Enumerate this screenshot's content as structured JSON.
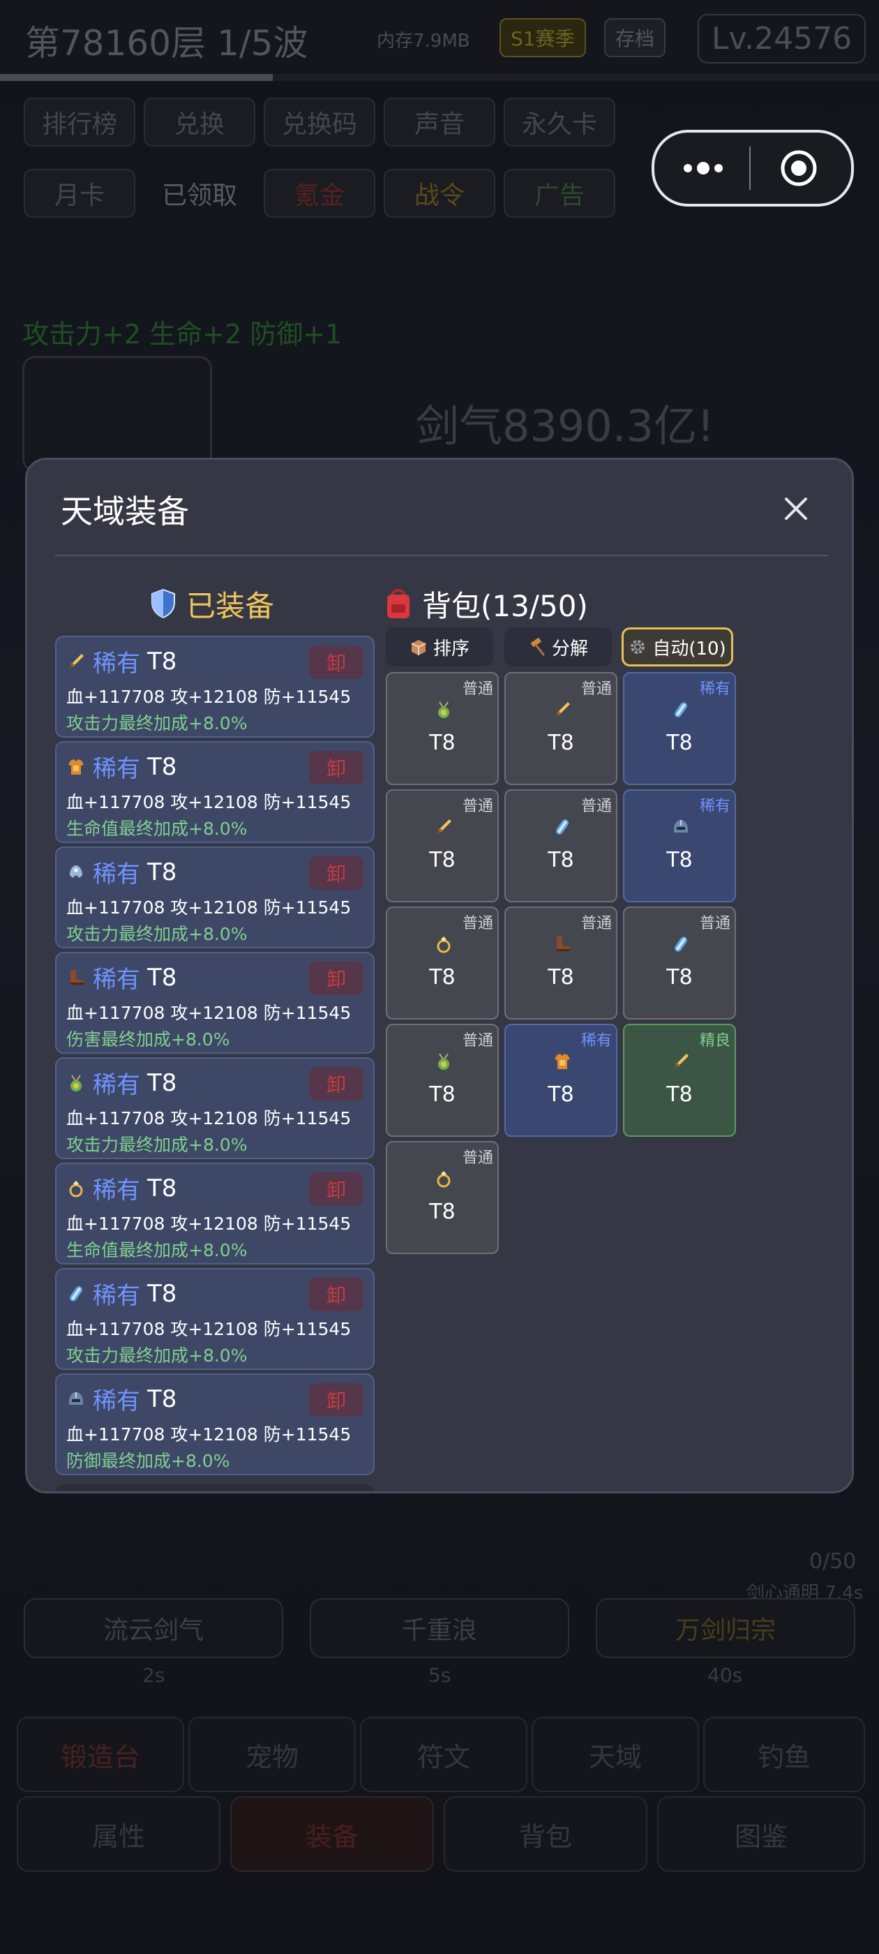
{
  "background": {
    "floor_label": "第78160层  1/5波",
    "memory_label": "内存7.9MB",
    "season_chip": "S1赛季",
    "save_chip": "存档",
    "level_chip": "Lv.24576",
    "progress_fraction": 0.31,
    "top_buttons": [
      "排行榜",
      "兑换",
      "兑换码",
      "声音",
      "永久卡"
    ],
    "second_buttons": [
      "月卡",
      "已领取",
      "氪金",
      "战令",
      "广告"
    ],
    "buff_text": "攻击力+2 生命+2 防御+1",
    "sword_qi": "剑气8390.3亿!",
    "skills": [
      {
        "name": "流云剑气",
        "cd": "2s"
      },
      {
        "name": "千重浪",
        "cd": "5s"
      },
      {
        "name": "万剑归宗",
        "cd": "40s"
      }
    ],
    "skill_count": "0/50",
    "skill_note": "剑心通明 7.4s",
    "nav_row1": [
      "锻造台",
      "宠物",
      "符文",
      "天域",
      "钓鱼"
    ],
    "nav_row2": [
      "属性",
      "装备",
      "背包",
      "图鉴"
    ]
  },
  "modal": {
    "title": "天域装备",
    "equipped": {
      "title": "已装备",
      "unequip_label": "卸",
      "items": [
        {
          "icon": "sword-icon",
          "rarity": "稀有",
          "tier": "T8",
          "stats": "血+117708 攻+12108 防+11545",
          "bonus": "攻击力最终加成+8.0%"
        },
        {
          "icon": "armor-icon",
          "rarity": "稀有",
          "tier": "T8",
          "stats": "血+117708 攻+12108 防+11545",
          "bonus": "生命值最终加成+8.0%"
        },
        {
          "icon": "shoulder-icon",
          "rarity": "稀有",
          "tier": "T8",
          "stats": "血+117708 攻+12108 防+11545",
          "bonus": "攻击力最终加成+8.0%"
        },
        {
          "icon": "boot-icon",
          "rarity": "稀有",
          "tier": "T8",
          "stats": "血+117708 攻+12108 防+11545",
          "bonus": "伤害最终加成+8.0%"
        },
        {
          "icon": "amulet-icon",
          "rarity": "稀有",
          "tier": "T8",
          "stats": "血+117708 攻+12108 防+11545",
          "bonus": "攻击力最终加成+8.0%"
        },
        {
          "icon": "ring-icon",
          "rarity": "稀有",
          "tier": "T8",
          "stats": "血+117708 攻+12108 防+11545",
          "bonus": "生命值最终加成+8.0%"
        },
        {
          "icon": "bracer-icon",
          "rarity": "稀有",
          "tier": "T8",
          "stats": "血+117708 攻+12108 防+11545",
          "bonus": "攻击力最终加成+8.0%"
        },
        {
          "icon": "helmet-icon",
          "rarity": "稀有",
          "tier": "T8",
          "stats": "血+117708 攻+12108 防+11545",
          "bonus": "防御最终加成+8.0%"
        }
      ]
    },
    "backpack": {
      "title": "背包(13/50)",
      "sort_label": "排序",
      "decompose_label": "分解",
      "auto_label": "自动(10)",
      "slots": [
        {
          "icon": "amulet-icon",
          "rarity": "普通",
          "tier": "T8"
        },
        {
          "icon": "sword-icon",
          "rarity": "普通",
          "tier": "T8"
        },
        {
          "icon": "bracer-icon",
          "rarity": "稀有",
          "tier": "T8"
        },
        {
          "icon": "sword-icon",
          "rarity": "普通",
          "tier": "T8"
        },
        {
          "icon": "bracer-icon",
          "rarity": "普通",
          "tier": "T8"
        },
        {
          "icon": "helmet-icon",
          "rarity": "稀有",
          "tier": "T8"
        },
        {
          "icon": "ring-icon",
          "rarity": "普通",
          "tier": "T8"
        },
        {
          "icon": "boot-icon",
          "rarity": "普通",
          "tier": "T8"
        },
        {
          "icon": "bracer-icon",
          "rarity": "普通",
          "tier": "T8"
        },
        {
          "icon": "amulet-icon",
          "rarity": "普通",
          "tier": "T8"
        },
        {
          "icon": "armor-icon",
          "rarity": "稀有",
          "tier": "T8"
        },
        {
          "icon": "sword-icon",
          "rarity": "精良",
          "tier": "T8"
        },
        {
          "icon": "ring-icon",
          "rarity": "普通",
          "tier": "T8"
        }
      ]
    }
  }
}
